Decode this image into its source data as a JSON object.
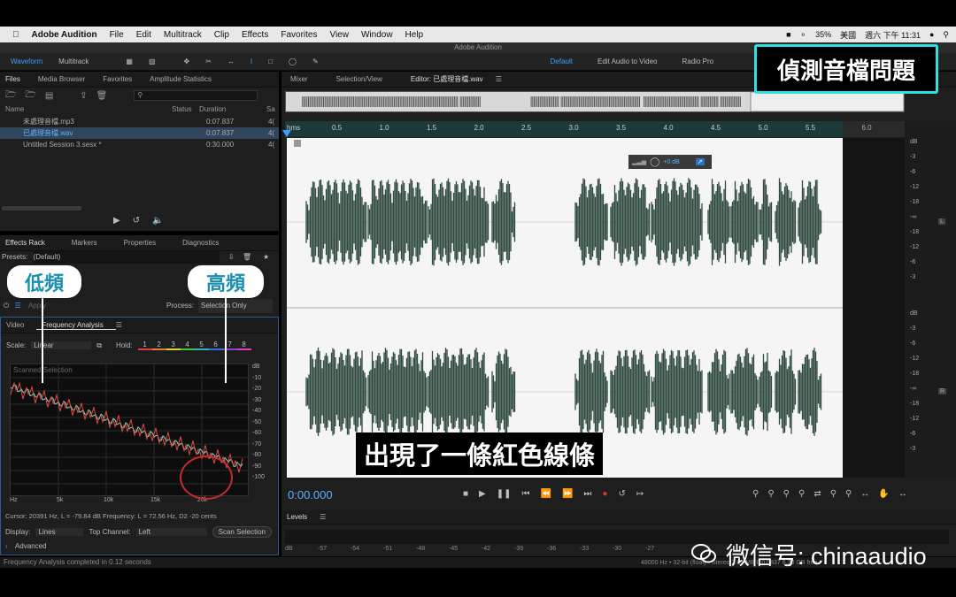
{
  "menubar": {
    "app_name": "Adobe Audition",
    "items": [
      "File",
      "Edit",
      "Multitrack",
      "Clip",
      "Effects",
      "Favorites",
      "View",
      "Window",
      "Help"
    ],
    "battery": "35%",
    "input_method": "美國",
    "clock": "週六 下午 11:31"
  },
  "window_title": "Adobe Audition",
  "toolbar": {
    "waveform_label": "Waveform",
    "multitrack_label": "Multitrack",
    "workspace_default": "Default",
    "workspace_video": "Edit Audio to Video",
    "workspace_radio": "Radio Pro"
  },
  "files_panel": {
    "tabs": [
      "Files",
      "Media Browser",
      "Favorites",
      "Amplitude Statistics"
    ],
    "columns": [
      "Name",
      "Status",
      "Duration",
      "Sa"
    ],
    "rows": [
      {
        "name": "未處理音檔.mp3",
        "duration": "0:07.837",
        "sa": "4("
      },
      {
        "name": "已處理音檔.wav",
        "duration": "0:07.837",
        "sa": "4("
      },
      {
        "name": "Untitled Session 3.sesx *",
        "duration": "0:30.000",
        "sa": "4("
      }
    ]
  },
  "effects_panel": {
    "tabs": [
      "Effects Rack",
      "Markers",
      "Properties",
      "Diagnostics"
    ],
    "presets_label": "Presets:",
    "presets_value": "(Default)",
    "apply_label": "Apply",
    "process_label": "Process:",
    "process_value": "Selection Only"
  },
  "freq_panel": {
    "tabs": [
      "Video",
      "Frequency Analysis"
    ],
    "scale_label": "Scale:",
    "scale_value": "Linear",
    "hold_label": "Hold:",
    "hold_numbers": [
      "1",
      "2",
      "3",
      "4",
      "5",
      "6",
      "7",
      "8"
    ],
    "hold_colors": [
      "#e04040",
      "#e08030",
      "#e0d030",
      "#50c040",
      "#30b0c0",
      "#3070e0",
      "#9040e0",
      "#e040c0"
    ],
    "plot_caption": "Scanned Selection",
    "db_ticks": [
      "dB",
      "-10",
      "-20",
      "-30",
      "-40",
      "-50",
      "-60",
      "-70",
      "-80",
      "-90",
      "-100"
    ],
    "hz_ticks": [
      "Hz",
      "5k",
      "10k",
      "15k",
      "20k"
    ],
    "cursor_info": "Cursor: 20391 Hz, L = -79.84 dB   Frequency: L = 72.56 Hz, D2 -20 cents",
    "display_label": "Display:",
    "display_value": "Lines",
    "top_channel_label": "Top Channel:",
    "top_channel_value": "Left",
    "scan_label": "Scan Selection",
    "advanced_label": "Advanced"
  },
  "status_text": "Frequency Analysis completed in 0.12 seconds",
  "editor": {
    "tabs": [
      "Mixer",
      "Selection/View",
      "Editor: 已處理音檔.wav"
    ],
    "ruler_label": "hms",
    "ruler_ticks": [
      "0.5",
      "1.0",
      "1.5",
      "2.0",
      "2.5",
      "3.0",
      "3.5",
      "4.0",
      "4.5",
      "5.0",
      "5.5",
      "6.0",
      "6.5"
    ],
    "hud_value": "+0 dB",
    "db_labels_top": [
      "dB",
      "-3",
      "-6",
      "-12",
      "-18",
      "-∞",
      "-18",
      "-12",
      "-6",
      "-3"
    ],
    "db_labels_bottom": [
      "dB",
      "-3",
      "-6",
      "-12",
      "-18",
      "-∞",
      "-18",
      "-12",
      "-6",
      "-3"
    ],
    "channel_l": "L",
    "channel_r": "R",
    "time_display": "0:00.000",
    "levels_label": "Levels",
    "levels_ticks": [
      "dB",
      "-57",
      "-54",
      "-51",
      "-48",
      "-45",
      "-42",
      "-39",
      "-36",
      "-33",
      "-30",
      "-27"
    ],
    "status_right": "48000 Hz • 32-bit (float) • Stereo   2.87 MB   0:07.837   6.30 GB free"
  },
  "overlay": {
    "title": "偵測音檔問題",
    "low_label": "低頻",
    "high_label": "高頻",
    "subtitle": "出現了一條紅色線條",
    "wechat": "微信号: chinaaudio"
  }
}
